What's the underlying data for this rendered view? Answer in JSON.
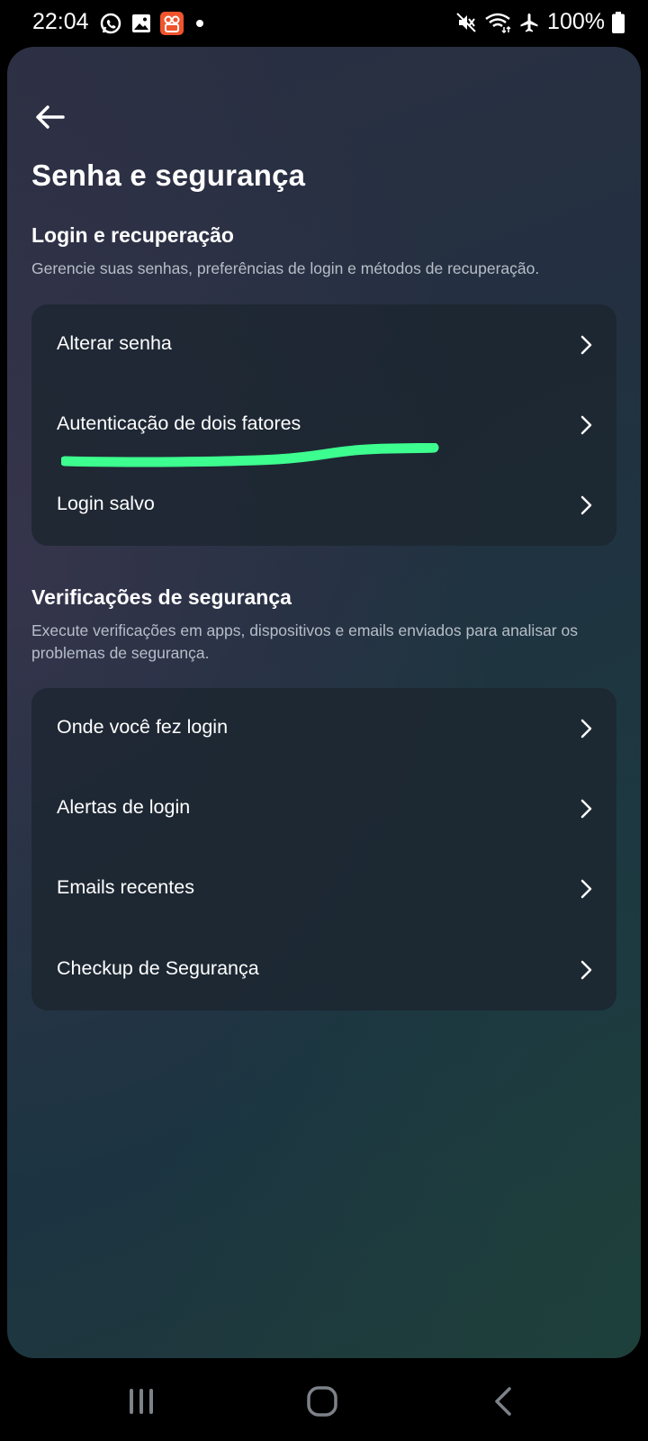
{
  "status_bar": {
    "time": "22:04",
    "battery": "100%",
    "left_icons": [
      "whatsapp-icon",
      "gallery-icon",
      "app-notification-icon",
      "more-dot-icon"
    ],
    "right_icons": [
      "mute-icon",
      "wifi-icon",
      "airplane-icon",
      "battery-icon"
    ],
    "notification_app_color": "#f0542d"
  },
  "header": {
    "back_icon": "back-arrow-icon",
    "title": "Senha e segurança"
  },
  "login_section": {
    "title": "Login e recuperação",
    "description": "Gerencie suas senhas, preferências de login e métodos de recuperação.",
    "items": [
      {
        "label": "Alterar senha"
      },
      {
        "label": "Autenticação de dois fatores"
      },
      {
        "label": "Login salvo"
      }
    ]
  },
  "security_section": {
    "title": "Verificações de segurança",
    "description": "Execute verificações em apps, dispositivos e emails enviados para analisar os problemas de segurança.",
    "items": [
      {
        "label": "Onde você fez login"
      },
      {
        "label": "Alertas de login"
      },
      {
        "label": "Emails recentes"
      },
      {
        "label": "Checkup de Segurança"
      }
    ]
  },
  "annotation": {
    "highlight_color": "#3dff8f"
  },
  "nav_bar": {
    "icons": [
      "recent-apps-icon",
      "home-icon",
      "system-back-icon"
    ]
  }
}
